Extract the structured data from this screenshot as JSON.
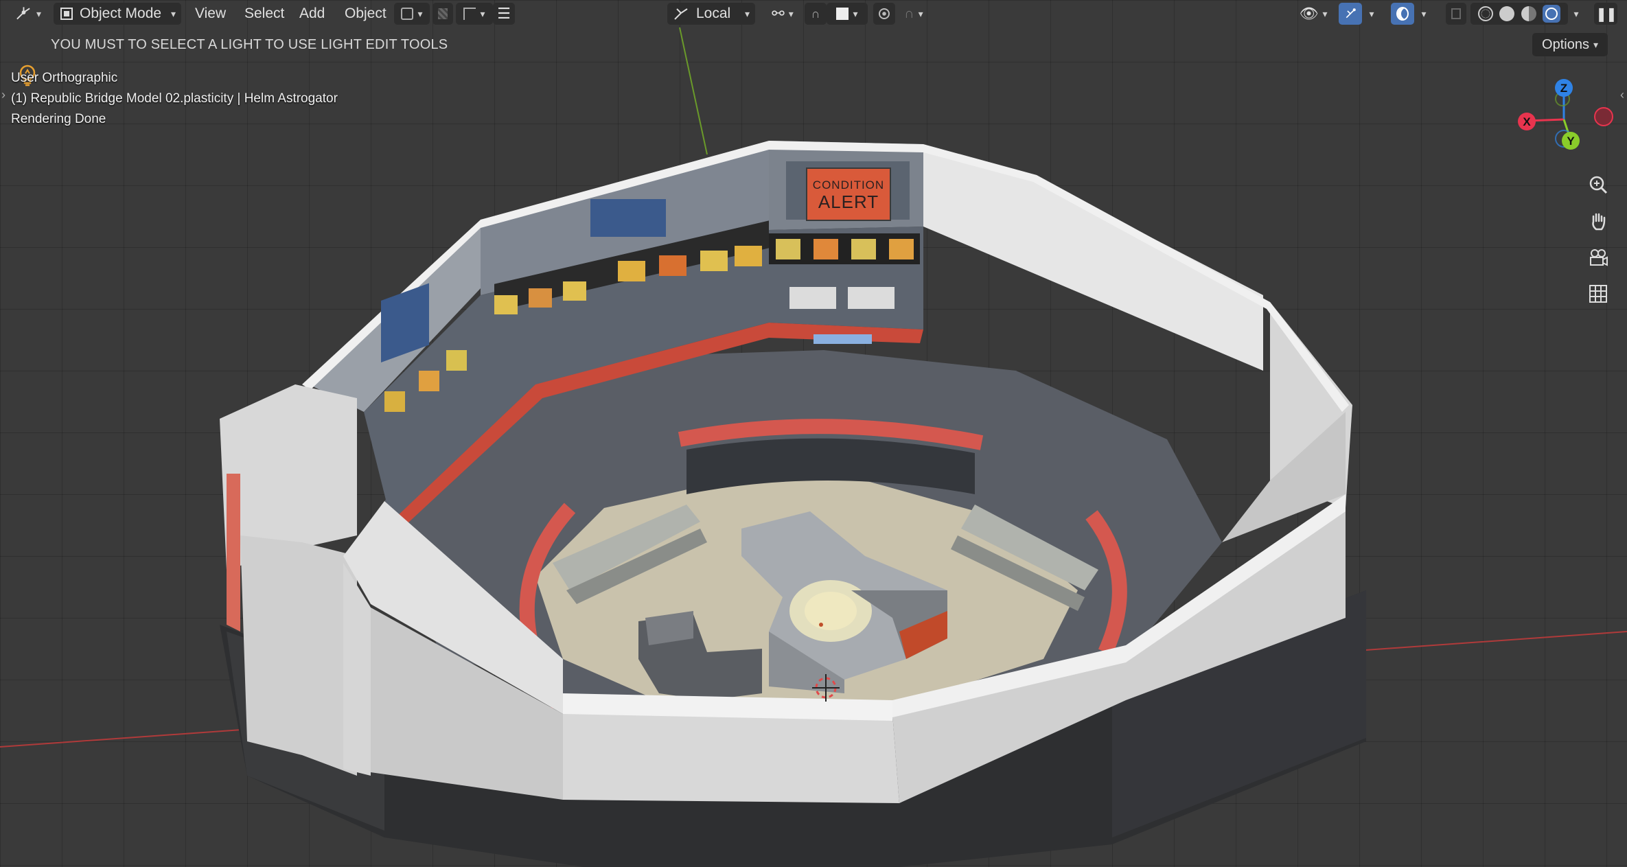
{
  "header": {
    "editor_type_icon": "transform-pivot-icon",
    "mode_label": "Object Mode",
    "menus": [
      "View",
      "Select",
      "Add",
      "Object"
    ],
    "transform_orientation": "Local",
    "toggle_overlay_active": true
  },
  "notice": {
    "icon": "lightbulb-icon",
    "text": "YOU MUST TO SELECT A LIGHT TO USE LIGHT EDIT TOOLS"
  },
  "options_label": "Options",
  "overlay_info": {
    "view": "User Orthographic",
    "object": "(1) Republic Bridge Model 02.plasticity | Helm Astrogator",
    "status": "Rendering Done"
  },
  "scene": {
    "alert_line1": "CONDITION",
    "alert_line2": "ALERT"
  },
  "gizmo": {
    "x_label": "X",
    "y_label": "Y",
    "z_label": "Z",
    "x_color": "#e8344e",
    "y_color": "#8acc2a",
    "z_color": "#2f83e6"
  },
  "nav_tools": [
    "zoom-icon",
    "pan-hand-icon",
    "camera-icon",
    "grid-icon"
  ],
  "colors": {
    "accent": "#4772b3",
    "viewport_bg": "#3a3a3a",
    "red_trim": "#d45a52"
  }
}
